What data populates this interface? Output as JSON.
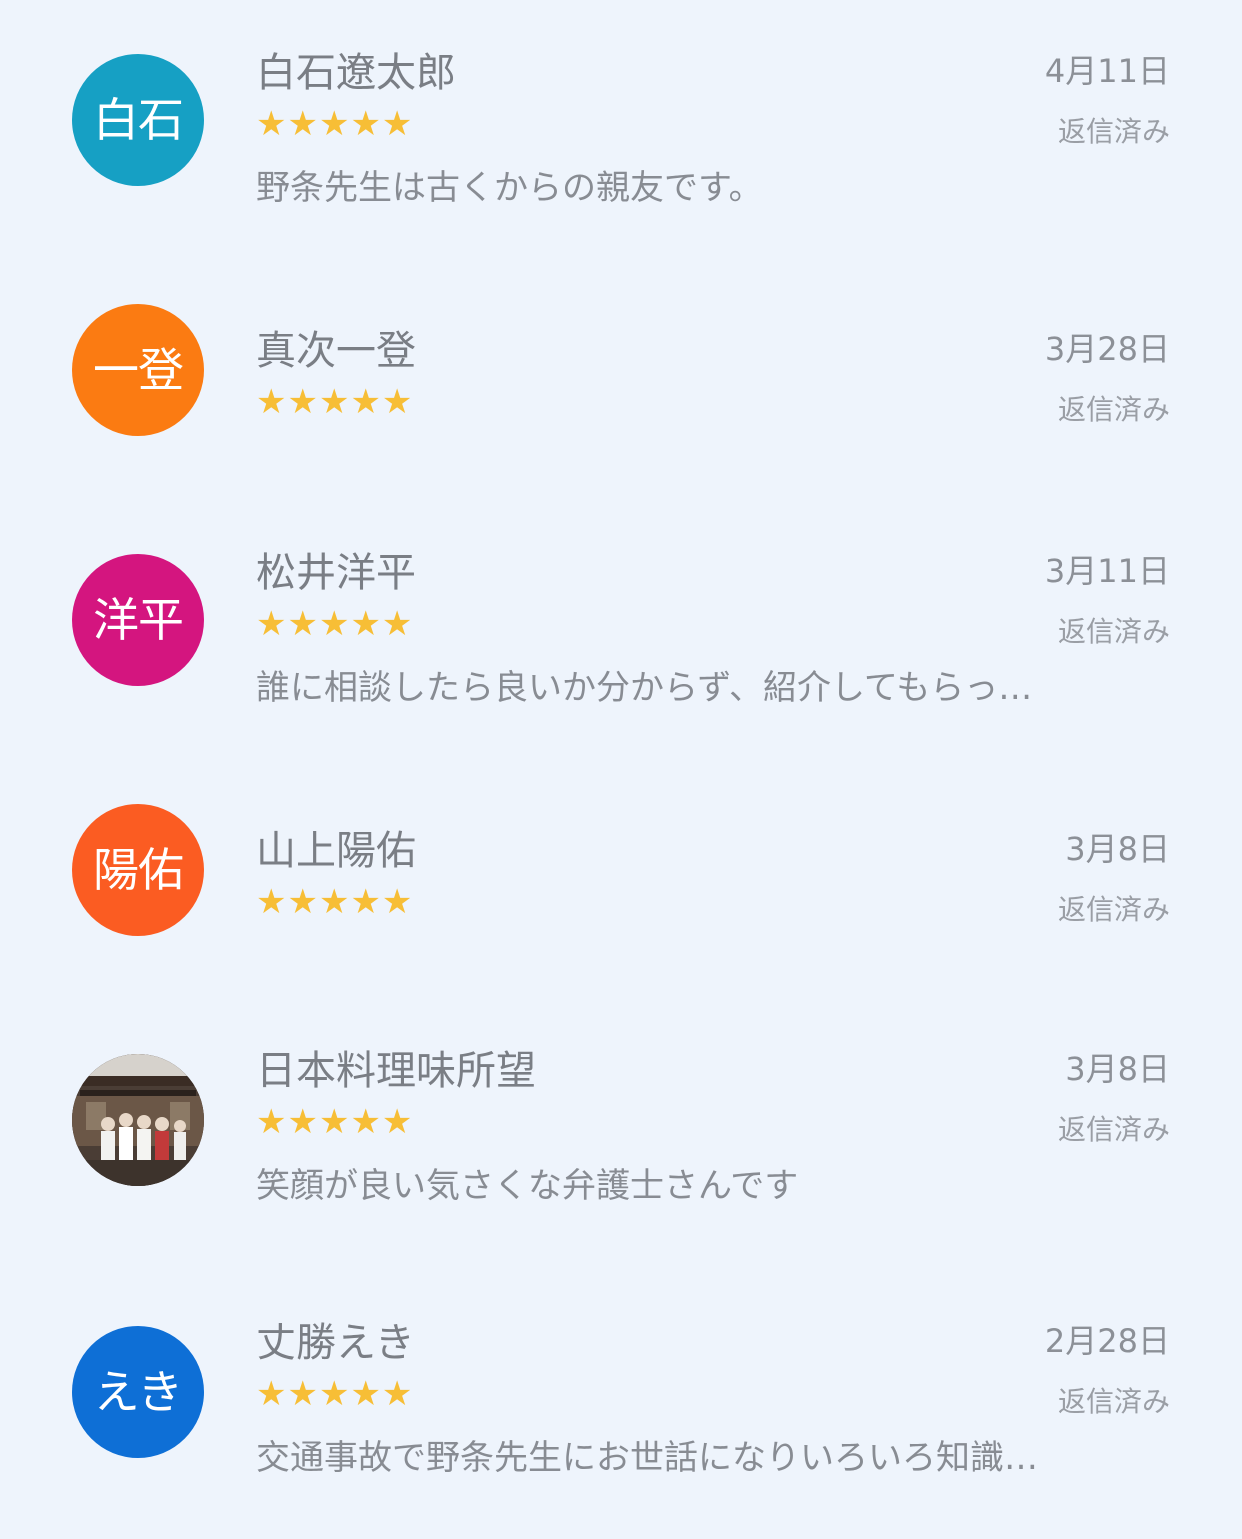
{
  "reviews": [
    {
      "avatar_text": "白石",
      "avatar_color": "#16a0c4",
      "name": "白石遼太郎",
      "rating": 5,
      "stars": "★★★★★",
      "comment": "野条先生は古くからの親友です。",
      "date": "4月11日",
      "status": "返信済み"
    },
    {
      "avatar_text": "一登",
      "avatar_color": "#fb7b12",
      "name": "真次一登",
      "rating": 5,
      "stars": "★★★★★",
      "comment": "",
      "date": "3月28日",
      "status": "返信済み"
    },
    {
      "avatar_text": "洋平",
      "avatar_color": "#d4157f",
      "name": "松井洋平",
      "rating": 5,
      "stars": "★★★★★",
      "comment": "誰に相談したら良いか分からず、紹介してもらっ…",
      "date": "3月11日",
      "status": "返信済み"
    },
    {
      "avatar_text": "陽佑",
      "avatar_color": "#fb5c22",
      "name": "山上陽佑",
      "rating": 5,
      "stars": "★★★★★",
      "comment": "",
      "date": "3月8日",
      "status": "返信済み"
    },
    {
      "avatar_text": "",
      "avatar_color": "#5a4c44",
      "name": "日本料理味所望",
      "rating": 5,
      "stars": "★★★★★",
      "comment": "笑顔が良い気さくな弁護士さんです",
      "date": "3月8日",
      "status": "返信済み"
    },
    {
      "avatar_text": "えき",
      "avatar_color": "#0e6fd6",
      "name": "丈勝えき",
      "rating": 5,
      "stars": "★★★★★",
      "comment": "交通事故で野条先生にお世話になりいろいろ知識…",
      "date": "2月28日",
      "status": "返信済み"
    }
  ]
}
